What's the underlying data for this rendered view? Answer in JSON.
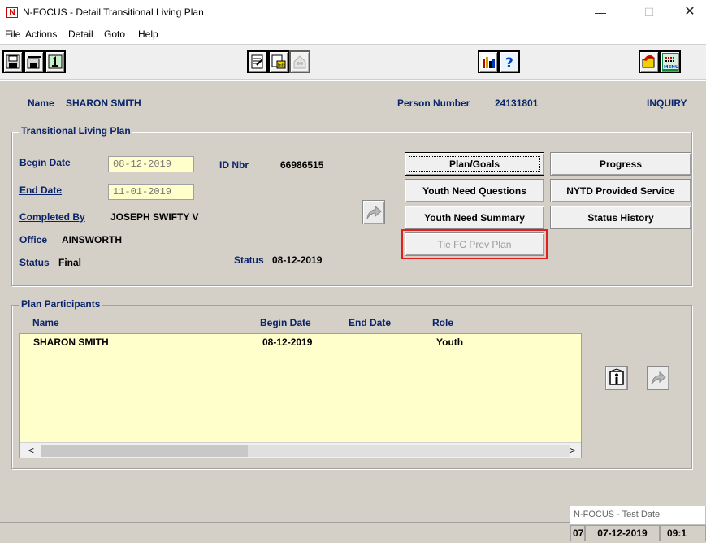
{
  "window": {
    "title": "N-FOCUS - Detail Transitional Living Plan",
    "app_icon_letter": "N",
    "minimize": "—",
    "maximize": "☐",
    "close": "✕"
  },
  "menu": [
    "File",
    "Actions",
    "Detail",
    "Goto",
    "Help"
  ],
  "header": {
    "name_label": "Name",
    "name_value": "SHARON SMITH",
    "person_number_label": "Person Number",
    "person_number_value": "24131801",
    "mode": "INQUIRY"
  },
  "plan": {
    "group_title": "Transitional Living Plan",
    "begin_date_label": "Begin Date",
    "begin_date_value": "08-12-2019",
    "end_date_label": "End Date",
    "end_date_value": "11-01-2019",
    "id_nbr_label": "ID Nbr",
    "id_nbr_value": "66986515",
    "completed_by_label": "Completed By",
    "completed_by_value": "JOSEPH SWIFTY V",
    "office_label": "Office",
    "office_value": "AINSWORTH",
    "status_label": "Status",
    "status_value": "Final",
    "status_date_label": "Status",
    "status_date_value": "08-12-2019"
  },
  "buttons": {
    "plan_goals": "Plan/Goals",
    "progress": "Progress",
    "youth_need_questions": "Youth Need Questions",
    "nytd_provided_service": "NYTD Provided Service",
    "youth_need_summary": "Youth Need Summary",
    "status_history": "Status History",
    "tie_fc_prev_plan": "Tie FC Prev Plan"
  },
  "participants": {
    "group_title": "Plan Participants",
    "columns": [
      "Name",
      "Begin Date",
      "End Date",
      "Role"
    ],
    "rows": [
      {
        "name": "SHARON SMITH",
        "begin_date": "08-12-2019",
        "end_date": "",
        "role": "Youth"
      }
    ],
    "scroll_left": "<",
    "scroll_right": ">"
  },
  "statusbar": {
    "tooltip": "N-FOCUS - Test Date",
    "cell1": "07-",
    "date": "07-12-2019",
    "time": "09:1"
  },
  "colors": {
    "panel": "#d4d0c8",
    "field": "#ffffcc",
    "navy": "#0a246a",
    "highlight": "#e02020"
  }
}
